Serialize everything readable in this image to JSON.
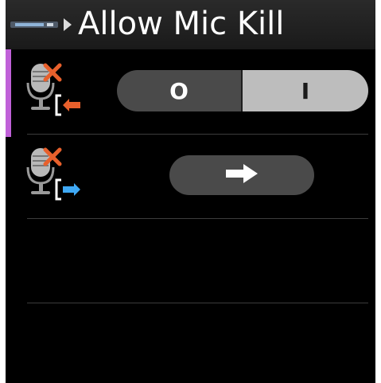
{
  "header": {
    "title": "Allow Mic Kill",
    "device_icon": "device-strip-icon",
    "breadcrumb_icon": "breadcrumb-arrow-icon"
  },
  "rows": [
    {
      "icon": "mic-kill-input-icon",
      "control": "toggle",
      "toggle": {
        "off_label": "O",
        "on_label": "I",
        "selected": "on"
      },
      "focused": true
    },
    {
      "icon": "mic-kill-output-icon",
      "control": "button",
      "button_icon": "arrow-right-icon",
      "focused": false
    }
  ],
  "colors": {
    "background": "#000000",
    "header": "#1f1f1f",
    "focus_accent": "#c061d8",
    "control_dark": "#4a4a4a",
    "control_selected": "#bdbdbd",
    "arrow_orange": "#e8602c",
    "arrow_blue": "#3fa9f5",
    "x_mark": "#e8602c"
  }
}
